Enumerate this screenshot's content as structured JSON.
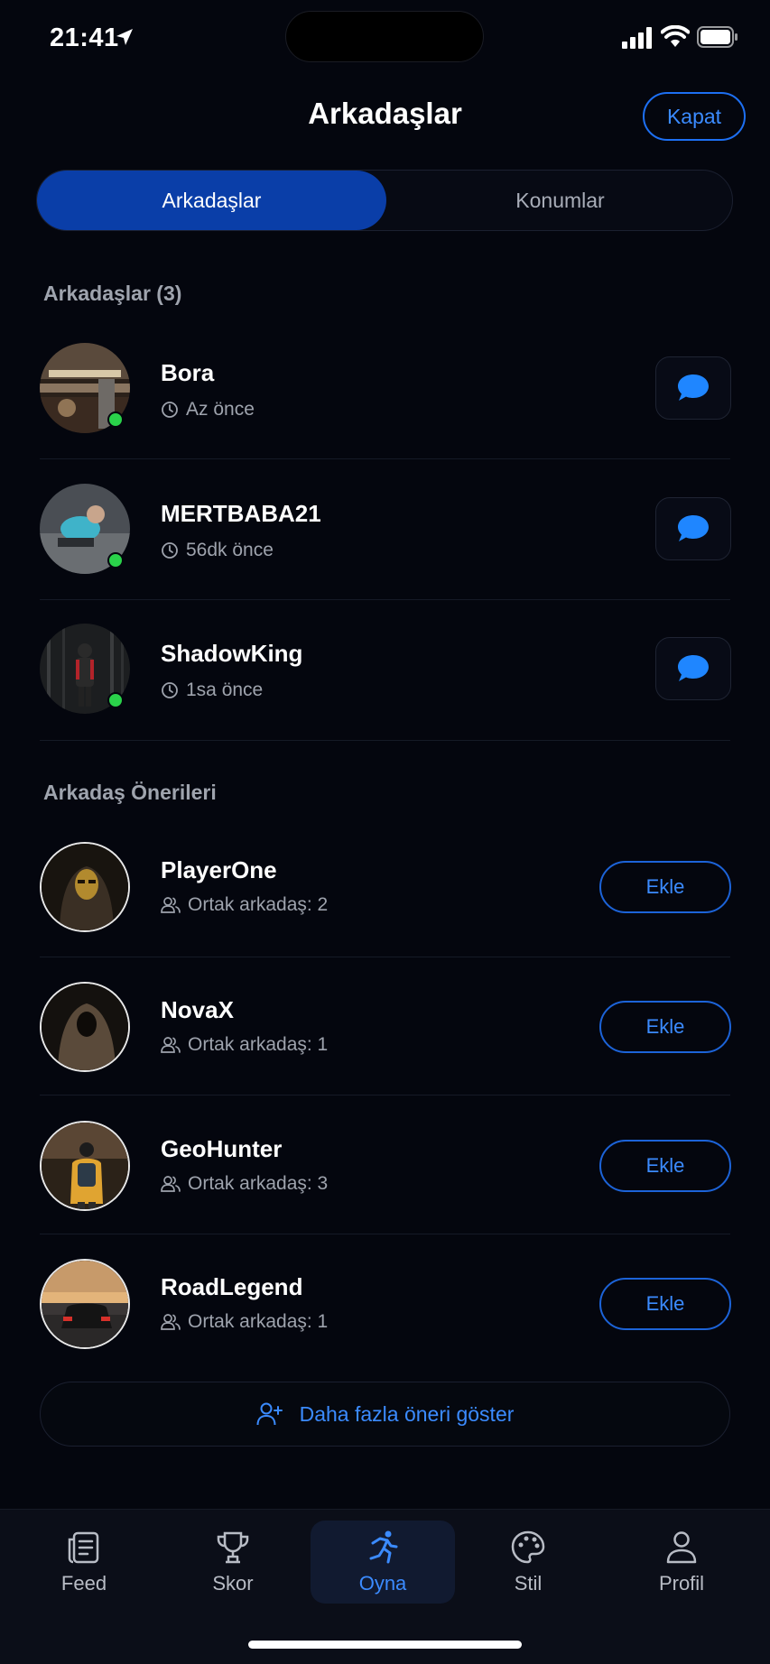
{
  "status_bar": {
    "time": "21:41"
  },
  "header": {
    "title": "Arkadaşlar",
    "close_label": "Kapat"
  },
  "segments": {
    "active": "Arkadaşlar",
    "inactive": "Konumlar"
  },
  "friends_section": {
    "title": "Arkadaşlar (3)",
    "items": [
      {
        "name": "Bora",
        "last_seen": "Az önce",
        "online": true
      },
      {
        "name": "MERTBABA21",
        "last_seen": "56dk önce",
        "online": true
      },
      {
        "name": "ShadowKing",
        "last_seen": "1sa önce",
        "online": true
      }
    ]
  },
  "suggestions_section": {
    "title": "Arkadaş Önerileri",
    "add_label": "Ekle",
    "items": [
      {
        "name": "PlayerOne",
        "mutual": "Ortak arkadaş: 2"
      },
      {
        "name": "NovaX",
        "mutual": "Ortak arkadaş: 1"
      },
      {
        "name": "GeoHunter",
        "mutual": "Ortak arkadaş: 3"
      },
      {
        "name": "RoadLegend",
        "mutual": "Ortak arkadaş: 1"
      }
    ],
    "more_label": "Daha fazla öneri göster"
  },
  "tabbar": {
    "items": [
      {
        "label": "Feed",
        "icon": "feed-icon"
      },
      {
        "label": "Skor",
        "icon": "trophy-icon"
      },
      {
        "label": "Oyna",
        "icon": "running-icon",
        "active": true
      },
      {
        "label": "Stil",
        "icon": "palette-icon"
      },
      {
        "label": "Profil",
        "icon": "person-icon"
      }
    ]
  },
  "colors": {
    "accent": "#3b8bff",
    "active_segment": "#0a3ea8",
    "online": "#2ad24a",
    "background": "#04060e"
  }
}
